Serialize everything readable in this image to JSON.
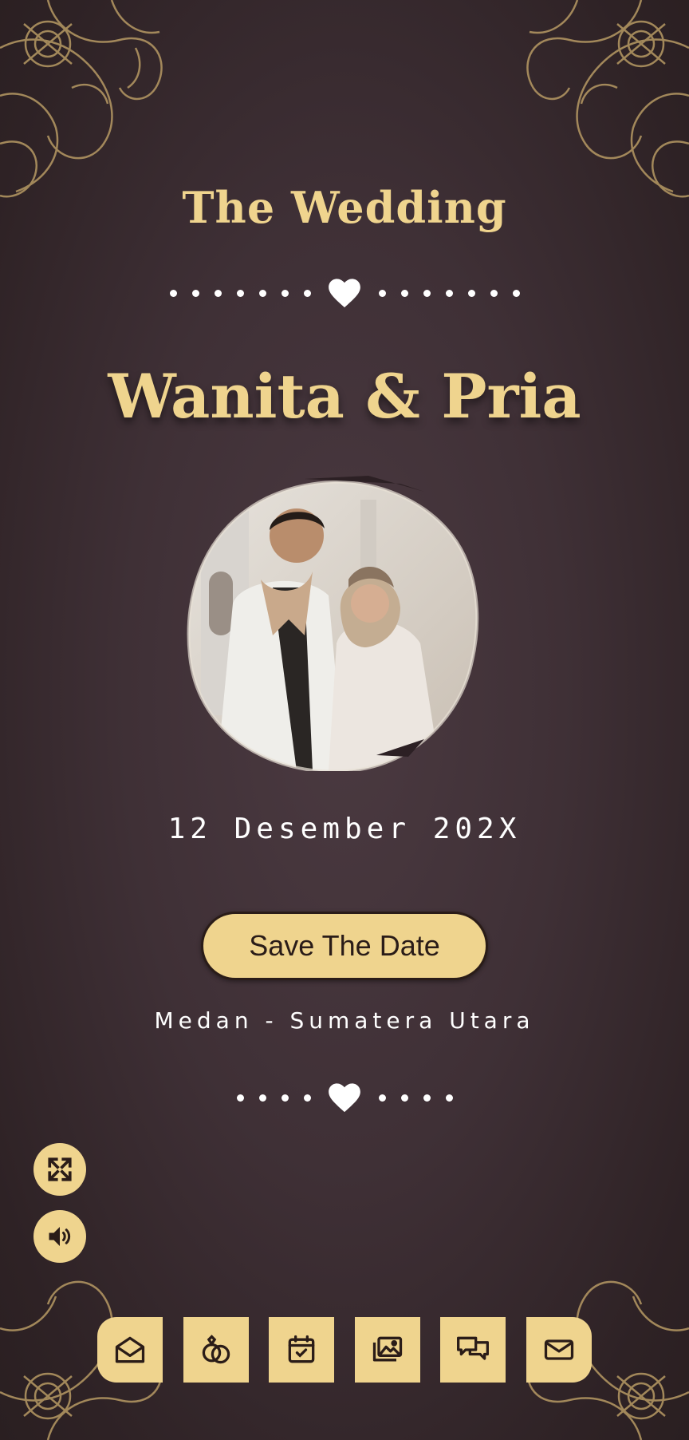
{
  "header": {
    "subtitle": "The Wedding",
    "couple_names": "Wanita & Pria"
  },
  "event": {
    "date": "12 Desember 202X",
    "save_button_label": "Save The Date",
    "location": "Medan - Sumatera Utara"
  },
  "floating_controls": [
    {
      "icon": "fullscreen-icon"
    },
    {
      "icon": "volume-icon"
    }
  ],
  "bottom_nav": [
    {
      "icon": "envelope-open-icon"
    },
    {
      "icon": "rings-icon"
    },
    {
      "icon": "calendar-check-icon"
    },
    {
      "icon": "gallery-icon"
    },
    {
      "icon": "chat-icon"
    },
    {
      "icon": "mail-icon"
    }
  ],
  "colors": {
    "background": "#3f3036",
    "gold": "#efd48e",
    "button_text": "#2a1c18"
  }
}
